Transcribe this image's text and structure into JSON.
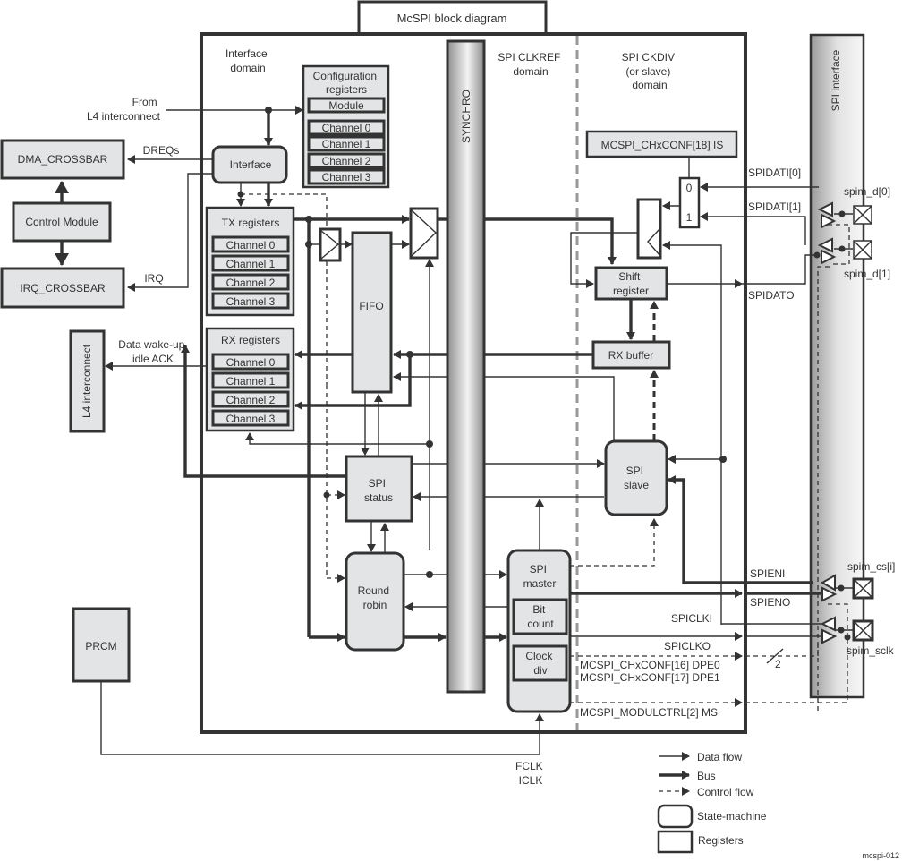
{
  "title": "McSPI block diagram",
  "figure_id": "mcspi-012",
  "domains": {
    "interface": [
      "Interface",
      "domain"
    ],
    "clkref": [
      "SPI CLKREF",
      "domain"
    ],
    "ckdiv": [
      "SPI CKDIV",
      "(or slave)",
      "domain"
    ]
  },
  "external": {
    "dma_crossbar": "DMA_CROSSBAR",
    "control_module": "Control Module",
    "irq_crossbar": "IRQ_CROSSBAR",
    "l4_interconnect": "L4 interconnect",
    "prcm": "PRCM"
  },
  "signals": {
    "from_l4": [
      "From",
      "L4 interconnect"
    ],
    "dreqs": "DREQs",
    "irq": "IRQ",
    "wakeup": [
      "Data wake-up",
      "idle ACK"
    ],
    "fclk": [
      "FCLK",
      "ICLK"
    ]
  },
  "blocks": {
    "config": {
      "title": [
        "Configuration",
        "registers"
      ],
      "items": [
        "Module",
        "Channel 0",
        "Channel 1",
        "Channel 2",
        "Channel 3"
      ]
    },
    "interface": "Interface",
    "tx": {
      "title": "TX registers",
      "items": [
        "Channel 0",
        "Channel 1",
        "Channel 2",
        "Channel 3"
      ]
    },
    "rx": {
      "title": "RX registers",
      "items": [
        "Channel 0",
        "Channel 1",
        "Channel 2",
        "Channel 3"
      ]
    },
    "fifo": "FIFO",
    "synchro": "SYNCHRO",
    "spi_status": [
      "SPI",
      "status"
    ],
    "round_robin": [
      "Round",
      "robin"
    ],
    "spi_master": [
      "SPI",
      "master"
    ],
    "bit_count": [
      "Bit",
      "count"
    ],
    "clock_div": [
      "Clock",
      "div"
    ],
    "spi_slave": [
      "SPI",
      "slave"
    ],
    "rx_buffer": "RX buffer",
    "shift_register": [
      "Shift",
      "register"
    ],
    "is_reg": "MCSPI_CHxCONF[18] IS",
    "mux_inputs": [
      "0",
      "1"
    ],
    "spi_interface": "SPI interface"
  },
  "spi_signals": {
    "spidati0": "SPIDATI[0]",
    "spidati1": "SPIDATI[1]",
    "spidato": "SPIDATO",
    "spieni": "SPIENI",
    "spieno": "SPIENO",
    "spiclki": "SPICLKI",
    "spiclko": "SPICLKO",
    "dpe0": "MCSPI_CHxCONF[16] DPE0",
    "dpe1": "MCSPI_CHxCONF[17] DPE1",
    "ms": "MCSPI_MODULCTRL[2] MS",
    "bus_width": "2"
  },
  "pins": {
    "d0": "spim_d[0]",
    "d1": "spim_d[1]",
    "cs": "spim_cs[i]",
    "sclk": "spim_sclk"
  },
  "legend": {
    "data_flow": "Data flow",
    "bus": "Bus",
    "control_flow": "Control flow",
    "state_machine": "State-machine",
    "registers": "Registers"
  }
}
